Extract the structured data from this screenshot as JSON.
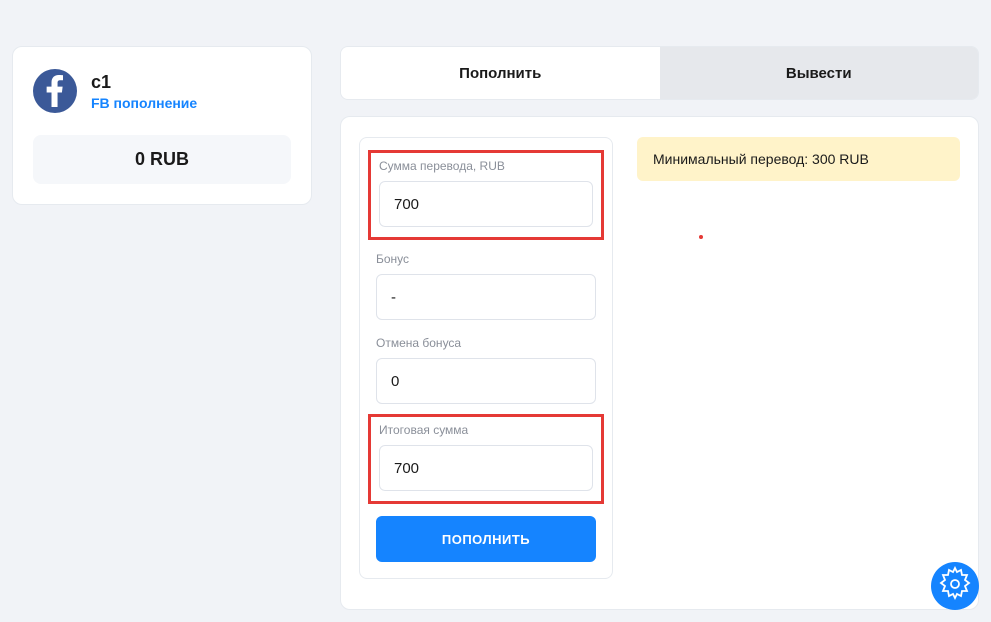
{
  "sidebar": {
    "account_name": "c1",
    "account_sub": "FB пополнение",
    "balance": "0 RUB"
  },
  "tabs": {
    "deposit": "Пополнить",
    "withdraw": "Вывести"
  },
  "form": {
    "amount_label": "Сумма перевода, RUB",
    "amount_value": "700",
    "bonus_label": "Бонус",
    "bonus_value": "-",
    "cancel_bonus_label": "Отмена бонуса",
    "cancel_bonus_value": "0",
    "total_label": "Итоговая сумма",
    "total_value": "700",
    "submit": "ПОПОЛНИТЬ"
  },
  "notice": {
    "min_transfer": "Минимальный перевод: 300 RUB"
  }
}
